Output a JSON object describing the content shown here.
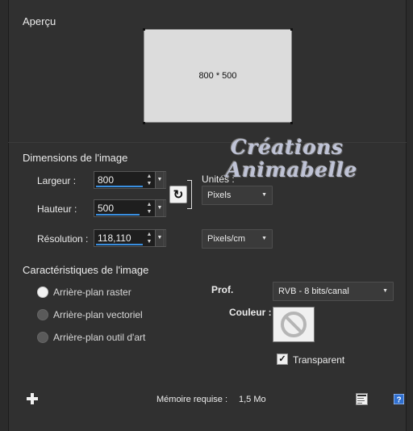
{
  "preview": {
    "title": "Aperçu",
    "size_label": "800 * 500"
  },
  "dimensions": {
    "title": "Dimensions de l'image",
    "width_label": "Largeur :",
    "width_value": "800",
    "height_label": "Hauteur :",
    "height_value": "500",
    "resolution_label": "Résolution :",
    "resolution_value": "118,110",
    "units_label": "Unités :",
    "units_value": "Pixels",
    "res_units_value": "Pixels/cm"
  },
  "watermark": {
    "line1": "Créations",
    "line2": "Animabelle"
  },
  "characteristics": {
    "title": "Caractéristiques de l'image",
    "options": [
      {
        "label": "Arrière-plan raster",
        "selected": true
      },
      {
        "label": "Arrière-plan vectoriel",
        "selected": false
      },
      {
        "label": "Arrière-plan outil d'art",
        "selected": false
      }
    ],
    "depth_label": "Prof.",
    "depth_value": "RVB - 8 bits/canal",
    "color_label": "Couleur :",
    "color_icon": "no-color-icon",
    "transparent_label": "Transparent",
    "transparent_checked": true
  },
  "footer": {
    "memory_label": "Mémoire requise :",
    "memory_value": "1,5 Mo",
    "add_icon": "plus-icon",
    "preset_icon": "preset-icon",
    "help_icon": "help-icon"
  },
  "colors": {
    "background": "#303030",
    "accent": "#3a8fe0"
  }
}
